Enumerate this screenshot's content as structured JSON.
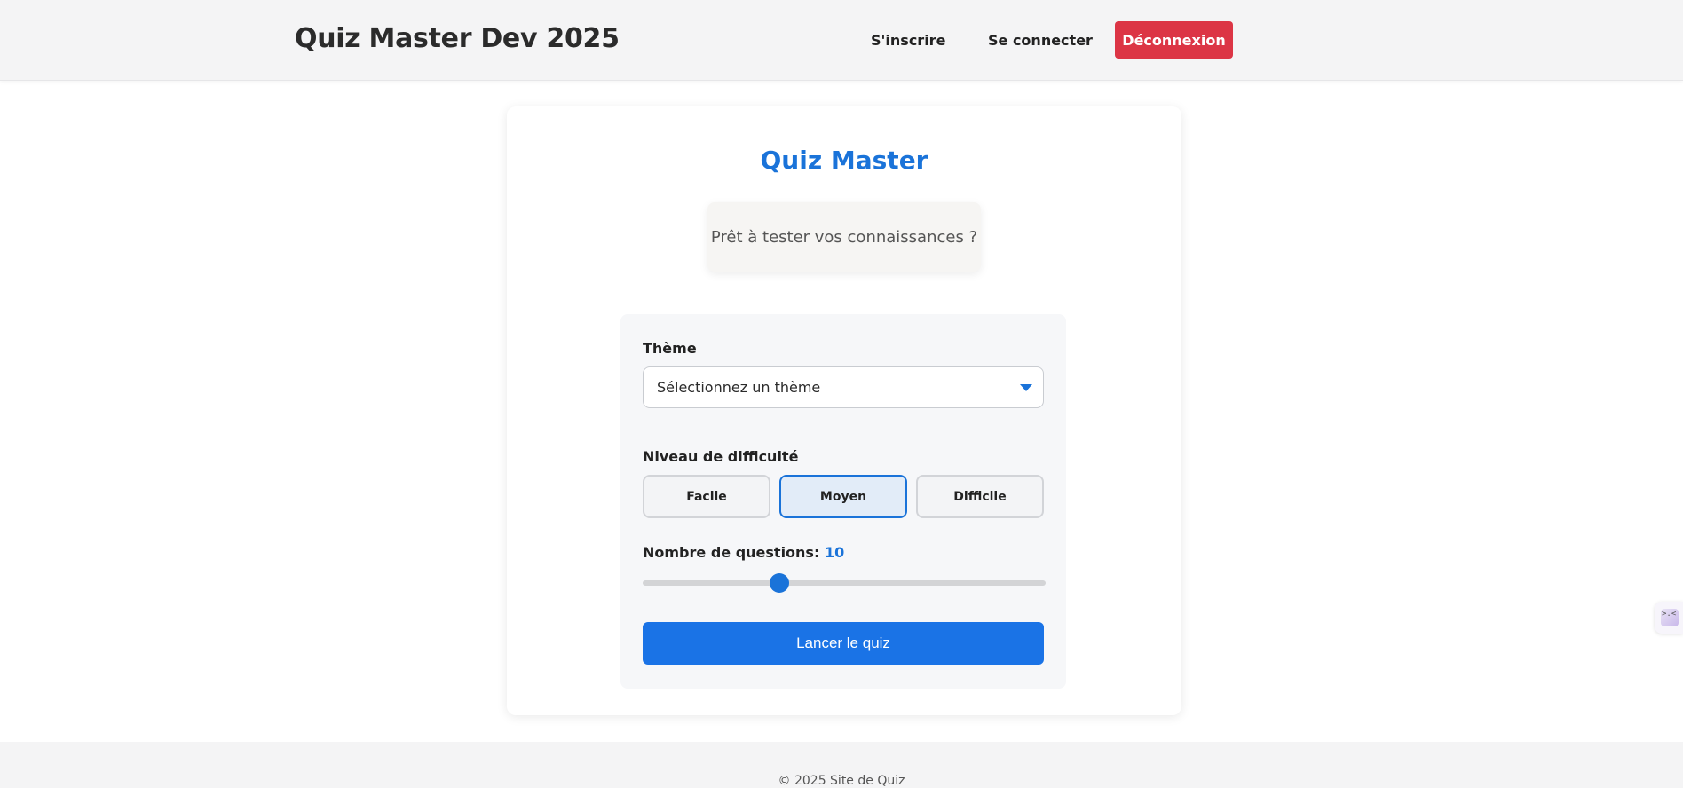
{
  "header": {
    "brand": "Quiz Master Dev 2025",
    "nav": {
      "signup": "S'inscrire",
      "login": "Se connecter",
      "logout": "Déconnexion"
    }
  },
  "card": {
    "title": "Quiz Master",
    "intro": "Prêt à tester vos connaissances ?"
  },
  "form": {
    "theme_label": "Thème",
    "theme_selected": "Sélectionnez un thème",
    "level_label": "Niveau de difficulté",
    "levels": [
      "Facile",
      "Moyen",
      "Difficile"
    ],
    "selected_level": "Moyen",
    "count_label": "Nombre de questions:",
    "count_value": "10",
    "slider_fraction": 0.34,
    "start_label": "Lancer le quiz"
  },
  "footer": {
    "text": "© 2025 Site de Quiz"
  },
  "colors": {
    "accent": "#1a73d9",
    "danger": "#dc3545"
  },
  "side_widget": {
    "icon": "extension-widget-icon",
    "glyph": ">.<"
  }
}
